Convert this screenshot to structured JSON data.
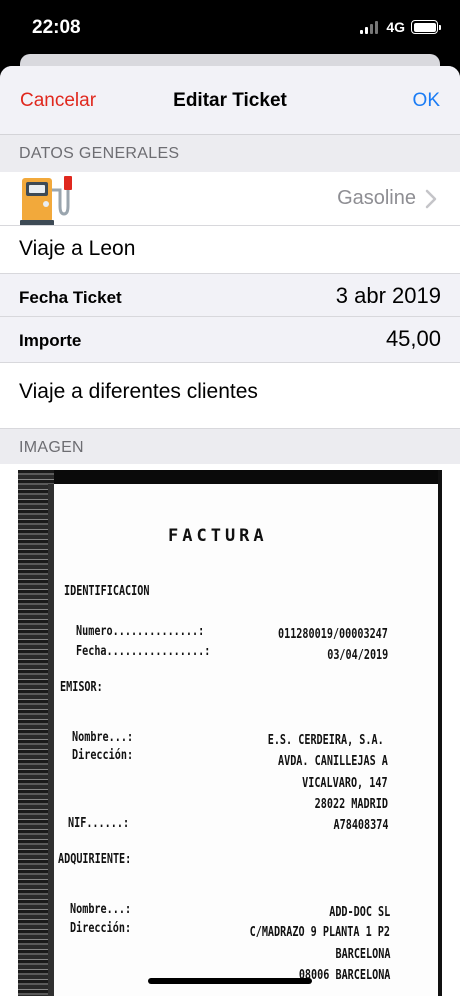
{
  "status_bar": {
    "time": "22:08",
    "network": "4G"
  },
  "nav": {
    "cancel_label": "Cancelar",
    "title": "Editar Ticket",
    "ok_label": "OK"
  },
  "sections": {
    "general_header": "DATOS GENERALES",
    "image_header": "IMAGEN"
  },
  "category": {
    "icon": "gas-pump-icon",
    "value": "Gasoline"
  },
  "description": "Viaje a Leon",
  "fields": {
    "date_label": "Fecha Ticket",
    "date_value": "3 abr 2019",
    "amount_label": "Importe",
    "amount_value": "45,00"
  },
  "notes": "Viaje a diferentes clientes",
  "colors": {
    "accent_ok": "#1a7cf5",
    "cancel": "#e0281e",
    "pump_orange": "#f2a93b"
  },
  "receipt": {
    "title": "FACTURA",
    "identificacion": "IDENTIFICACION",
    "numero_label": "Numero..............:",
    "numero_value": "011280019/00003247",
    "fecha_label": "Fecha................:",
    "fecha_value": "03/04/2019",
    "emisor": "EMISOR:",
    "nombre_label": "Nombre...:",
    "emisor_nombre": "E.S. CERDEIRA, S.A.",
    "direccion_label": "Dirección:",
    "emisor_dir1": "AVDA. CANILLEJAS A",
    "emisor_dir2": "VICALVARO, 147",
    "emisor_dir3": "28022 MADRID",
    "nif_label": "NIF......:",
    "emisor_nif": "A78408374",
    "adquiriente": "ADQUIRIENTE:",
    "adq_nombre": "ADD-DOC SL",
    "adq_dir1": "C/MADRAZO 9 PLANTA 1 P2",
    "adq_dir2": "BARCELONA",
    "adq_dir3": "08006 BARCELONA"
  }
}
